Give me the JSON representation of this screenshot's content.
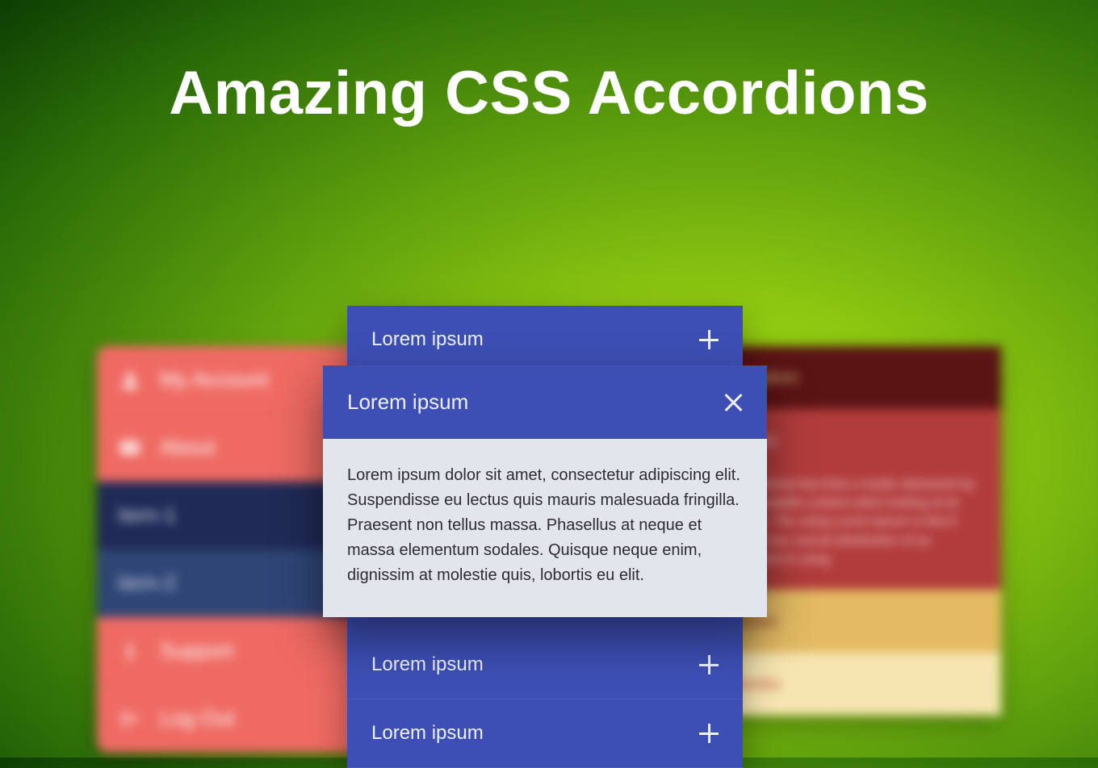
{
  "title": "Amazing CSS Accordions",
  "leftMenu": {
    "items": [
      {
        "label": "My Account",
        "icon": "user"
      },
      {
        "label": "About",
        "icon": "card"
      },
      {
        "label": "item-1",
        "icon": ""
      },
      {
        "label": "item-2",
        "icon": ""
      },
      {
        "label": "Support",
        "icon": "info"
      },
      {
        "label": "Log Out",
        "icon": "logout"
      }
    ]
  },
  "rightList": {
    "items": [
      {
        "label": "Location"
      },
      {
        "label": "Music"
      },
      {
        "body": "established fact that a reader distracted by the readable content when looking at its layout. The using Lorem Ipsum is that it has a less normal distribution of as opposed to using"
      },
      {
        "label": "Notes"
      },
      {
        "label": "Books"
      }
    ]
  },
  "backAccordion": {
    "items": [
      {
        "label": "Lorem ipsum"
      },
      {
        "label": "Lorem ipsum"
      },
      {
        "label": "Lorem ipsum"
      }
    ]
  },
  "frontCard": {
    "header": "Lorem ipsum",
    "body": "Lorem ipsum dolor sit amet, consectetur adipiscing elit. Suspendisse eu lectus quis mauris malesuada fringilla. Praesent non tellus massa. Phasellus at neque et massa elementum sodales. Quisque neque enim, dignissim at molestie quis, lobortis eu elit."
  }
}
